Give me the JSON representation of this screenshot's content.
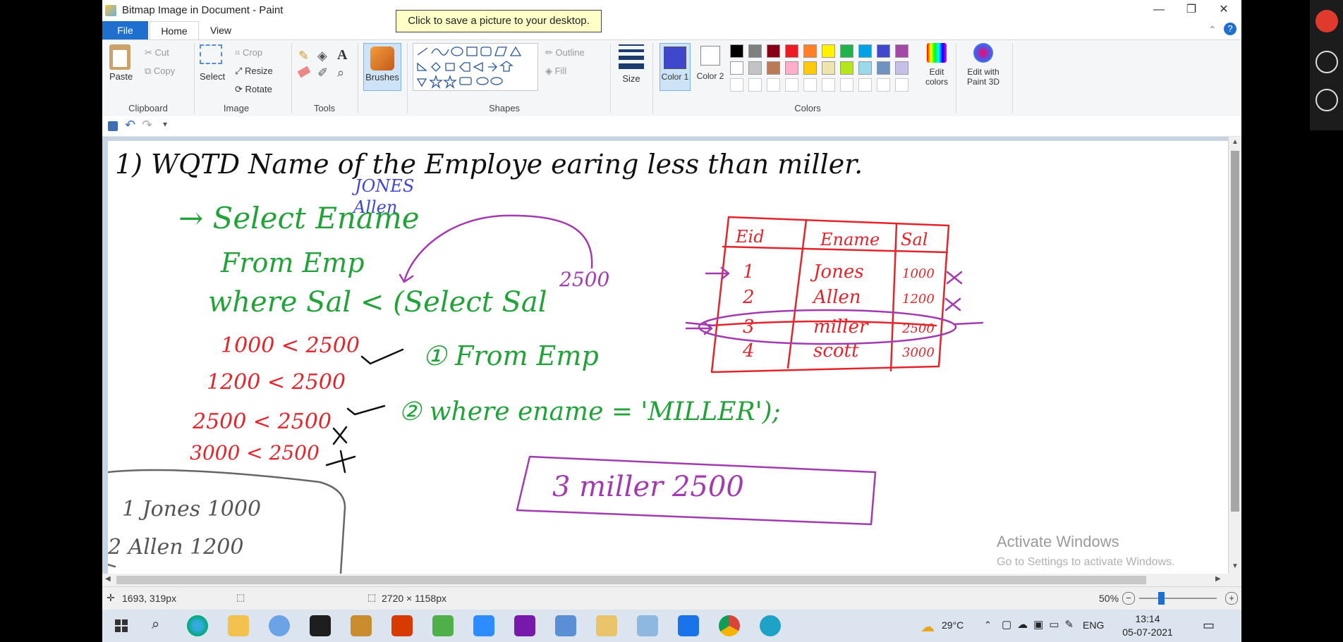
{
  "window": {
    "title": "Bitmap Image in Document - Paint",
    "tooltip": "Click to save a picture to your desktop.",
    "controls": {
      "minimize": "—",
      "maximize": "❐",
      "close": "✕"
    }
  },
  "tabs": {
    "file": "File",
    "home": "Home",
    "view": "View"
  },
  "ribbon": {
    "clipboard": {
      "paste": "Paste",
      "cut": "Cut",
      "copy": "Copy",
      "label": "Clipboard"
    },
    "image": {
      "select": "Select",
      "crop": "Crop",
      "resize": "Resize",
      "rotate": "Rotate",
      "label": "Image"
    },
    "tools": {
      "label": "Tools"
    },
    "brushes": {
      "label": "Brushes"
    },
    "shapes": {
      "outline": "Outline",
      "fill": "Fill",
      "label": "Shapes"
    },
    "size": {
      "label": "Size"
    },
    "colors": {
      "color1": "Color 1",
      "color2": "Color 2",
      "edit_colors": "Edit colors",
      "edit_paint3d": "Edit with Paint 3D",
      "label": "Colors",
      "color1_value": "#3f48cc",
      "palette_row1": [
        "#000000",
        "#7f7f7f",
        "#880015",
        "#ed1c24",
        "#ff7f27",
        "#fff200",
        "#22b14c",
        "#00a2e8",
        "#3f48cc",
        "#a349a4"
      ],
      "palette_row2": [
        "#ffffff",
        "#c3c3c3",
        "#b97a57",
        "#ffaec9",
        "#ffc90e",
        "#efe4b0",
        "#b5e61d",
        "#99d9ea",
        "#7092be",
        "#c8bfe7"
      ]
    }
  },
  "status": {
    "cursor_pos": "1693, 319px",
    "image_size": "2720 × 1158px",
    "zoom": "50%"
  },
  "watermark": {
    "line1": "Activate Windows",
    "line2": "Go to Settings to activate Windows."
  },
  "drawing": {
    "question": "1) WQTD Name of the Employe earing less than miller.",
    "names_blue": [
      "JONES",
      "Allen"
    ],
    "query_lines": [
      "→ Select Ename",
      "From Emp",
      "where Sal < (Select Sal"
    ],
    "subquery_lines": [
      "① From Emp",
      "② where ename = 'MILLER');"
    ],
    "number_2500": "2500",
    "comparisons": [
      "1000 < 2500",
      "1200 < 2500",
      "2500 < 2500",
      "3000 < 2500"
    ],
    "table_headers": [
      "Eid",
      "Ename",
      "Sal"
    ],
    "table_rows": [
      [
        "1",
        "Jones",
        "1000"
      ],
      [
        "2",
        "Allen",
        "1200"
      ],
      [
        "3",
        "miller",
        "2500"
      ],
      [
        "4",
        "scott",
        "3000"
      ]
    ],
    "result_box": "3  miller  2500",
    "grey_box_lines": [
      "1  Jones  1000",
      "2  Allen  1200"
    ]
  },
  "taskbar": {
    "weather": "29°C",
    "language": "ENG",
    "time": "13:14",
    "date": "05-07-2021"
  }
}
